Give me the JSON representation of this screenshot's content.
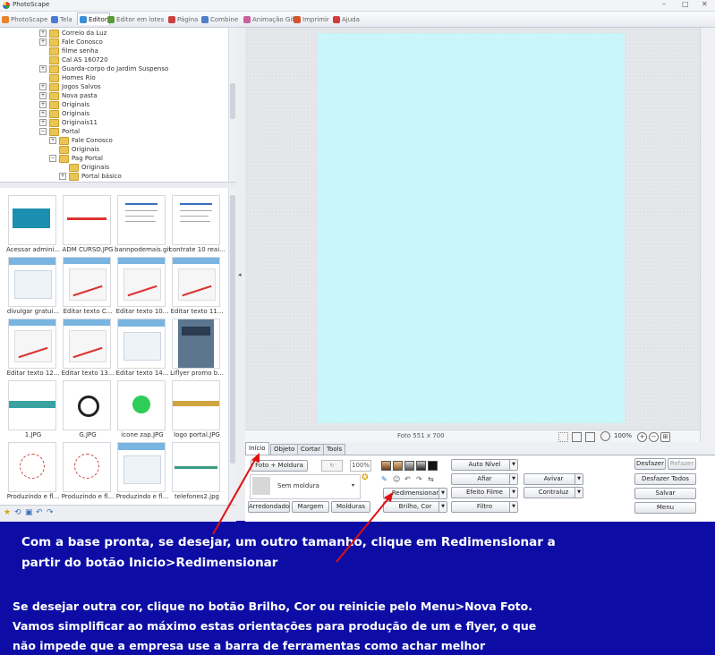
{
  "window": {
    "title": "PhotoScape",
    "minimize": "–",
    "restore": "□",
    "close": "✕"
  },
  "tabs": [
    {
      "label": "PhotoScape",
      "icon": "photoscape-icon",
      "color": "#e8832a"
    },
    {
      "label": "Tela",
      "icon": "viewer-icon",
      "color": "#4a7bd0"
    },
    {
      "label": "Editor",
      "icon": "editor-icon",
      "color": "#3b8fd8",
      "active": true
    },
    {
      "label": "Editor em lotes",
      "icon": "batch-editor-icon",
      "color": "#5a9a3a"
    },
    {
      "label": "Página",
      "icon": "page-icon",
      "color": "#c94040"
    },
    {
      "label": "Combine",
      "icon": "combine-icon",
      "color": "#4e7fc8"
    },
    {
      "label": "Animação Gif",
      "icon": "gif-icon",
      "color": "#c95fa0"
    },
    {
      "label": "Imprimir",
      "icon": "print-icon",
      "color": "#d3542d"
    },
    {
      "label": "Ajuda",
      "icon": "help-icon",
      "color": "#d23b3b"
    }
  ],
  "tree": [
    {
      "label": "Correio da Luz",
      "indent": 2,
      "expander": "+"
    },
    {
      "label": "Fale Conosco",
      "indent": 2,
      "expander": "+"
    },
    {
      "label": "filme senha",
      "indent": 2,
      "expander": ""
    },
    {
      "label": "Cal AS 160720",
      "indent": 2,
      "expander": ""
    },
    {
      "label": "Guarda-corpo do Jardim Suspenso",
      "indent": 2,
      "expander": "+"
    },
    {
      "label": "Homes Rio",
      "indent": 2,
      "expander": ""
    },
    {
      "label": "Jogos Salvos",
      "indent": 2,
      "expander": "+"
    },
    {
      "label": "Nova pasta",
      "indent": 2,
      "expander": "+"
    },
    {
      "label": "Originais",
      "indent": 2,
      "expander": "+"
    },
    {
      "label": "Originais",
      "indent": 2,
      "expander": "+"
    },
    {
      "label": "Originais11",
      "indent": 2,
      "expander": "+"
    },
    {
      "label": "Portal",
      "indent": 2,
      "expander": "−"
    },
    {
      "label": "Fale Conosco",
      "indent": 3,
      "expander": "+"
    },
    {
      "label": "Originais",
      "indent": 3,
      "expander": ""
    },
    {
      "label": "Pag Portal",
      "indent": 3,
      "expander": "−"
    },
    {
      "label": "Originais",
      "indent": 4,
      "expander": ""
    },
    {
      "label": "Portal básico",
      "indent": 4,
      "expander": "+"
    }
  ],
  "thumbnails": [
    {
      "caption": "Acessar admini...",
      "kind": "teal"
    },
    {
      "caption": "ADM CURSO.JPG",
      "kind": "redline"
    },
    {
      "caption": "bannpodemais.gif",
      "kind": "doc"
    },
    {
      "caption": "contrate 10 reai...",
      "kind": "doc"
    },
    {
      "caption": "divulgar gratui...",
      "kind": "web"
    },
    {
      "caption": "Editar texto C...",
      "kind": "webred"
    },
    {
      "caption": "Editar texto 10...",
      "kind": "webred"
    },
    {
      "caption": "Editar texto 11...",
      "kind": "webred"
    },
    {
      "caption": "Editar texto 12...",
      "kind": "webred"
    },
    {
      "caption": "Editar texto 13...",
      "kind": "webred"
    },
    {
      "caption": "Editar texto 14...",
      "kind": "web"
    },
    {
      "caption": "Liflyer promo b...",
      "kind": "flyer"
    },
    {
      "caption": "1.JPG",
      "kind": "strip"
    },
    {
      "caption": "G.JPG",
      "kind": "logo"
    },
    {
      "caption": "icone zap.JPG",
      "kind": "whatsapp"
    },
    {
      "caption": "logo portal.JPG",
      "kind": "stripgold"
    },
    {
      "caption": "Produzindo e fl...",
      "kind": "circle"
    },
    {
      "caption": "Produzindo e fl...",
      "kind": "circle"
    },
    {
      "caption": "Produzindo e fl...",
      "kind": "web"
    },
    {
      "caption": "telefones2.jpg",
      "kind": "phones"
    }
  ],
  "bottom_tools": [
    "star-icon",
    "rotate-icon",
    "jpg-icon",
    "undo-icon",
    "redo-icon"
  ],
  "infobar": {
    "photo_size": "Foto 551 x 700",
    "zoom": "100%"
  },
  "editor_tabs": [
    "Início",
    "Objeto",
    "Cortar",
    "Tools"
  ],
  "editor": {
    "photo_frame_button": "Foto + Moldura",
    "percent_value": "100%",
    "frame_select": "Sem moldura",
    "rounded_button": "Arredondado",
    "margin_button": "Margem",
    "frames_button": "Molduras",
    "resize_button": "Redimensionar",
    "brightness_button": "Brilho, Cor",
    "auto_level_button": "Auto Nível",
    "sharpen_button": "Afiar",
    "photo_film_button": "Efeito Filme",
    "filter_button": "Filtro",
    "soften_button": "Avivar",
    "backlight_button": "Contraluz",
    "undo_button": "Desfazer",
    "redo_button": "Refazer",
    "undo_all_button": "Desfazer Todos",
    "save_button": "Salvar",
    "menu_button": "Menu"
  },
  "colors": {
    "canvas": "#c9f6f9",
    "background_blue": "#0d0da6",
    "arrow_red": "#e01010"
  },
  "instructions": {
    "line1": "Com a base pronta, se desejar, um outro tamanho, clique em Redimensionar a",
    "line2": "partir do botão Inicio>Redimensionar",
    "line3": "Se desejar outra cor, clique no botão Brilho, Cor ou reinicie pelo Menu>Nova Foto.",
    "line4": "Vamos simplificar ao máximo estas orientações para produção de um e flyer, o que",
    "line5": "não impede que a empresa use a barra de ferramentas como achar melhor"
  }
}
